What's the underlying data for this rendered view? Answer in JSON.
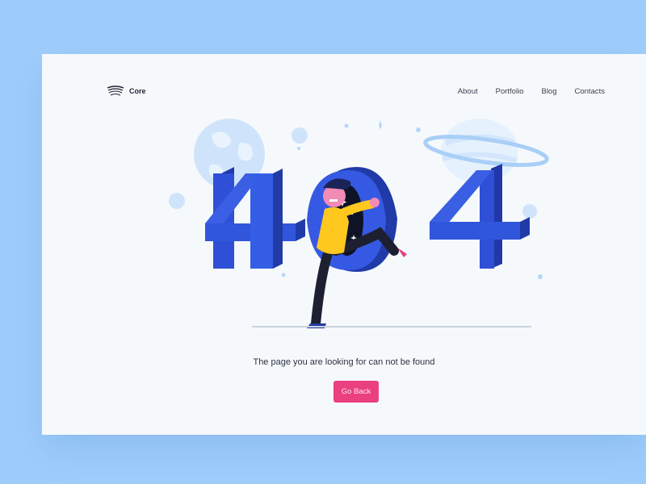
{
  "brand": {
    "name": "Core",
    "icon": "core-logo-icon"
  },
  "nav": {
    "items": [
      {
        "label": "About"
      },
      {
        "label": "Portfolio"
      },
      {
        "label": "Blog"
      },
      {
        "label": "Contacts"
      }
    ]
  },
  "hero": {
    "code_text": "404",
    "message": "The page you are looking for can not be found",
    "button_label": "Go Back"
  },
  "colors": {
    "page_background": "#9fcdfb",
    "card_background": "#f6f9fc",
    "digits": "#3057e0",
    "button": "#ea3f80"
  }
}
